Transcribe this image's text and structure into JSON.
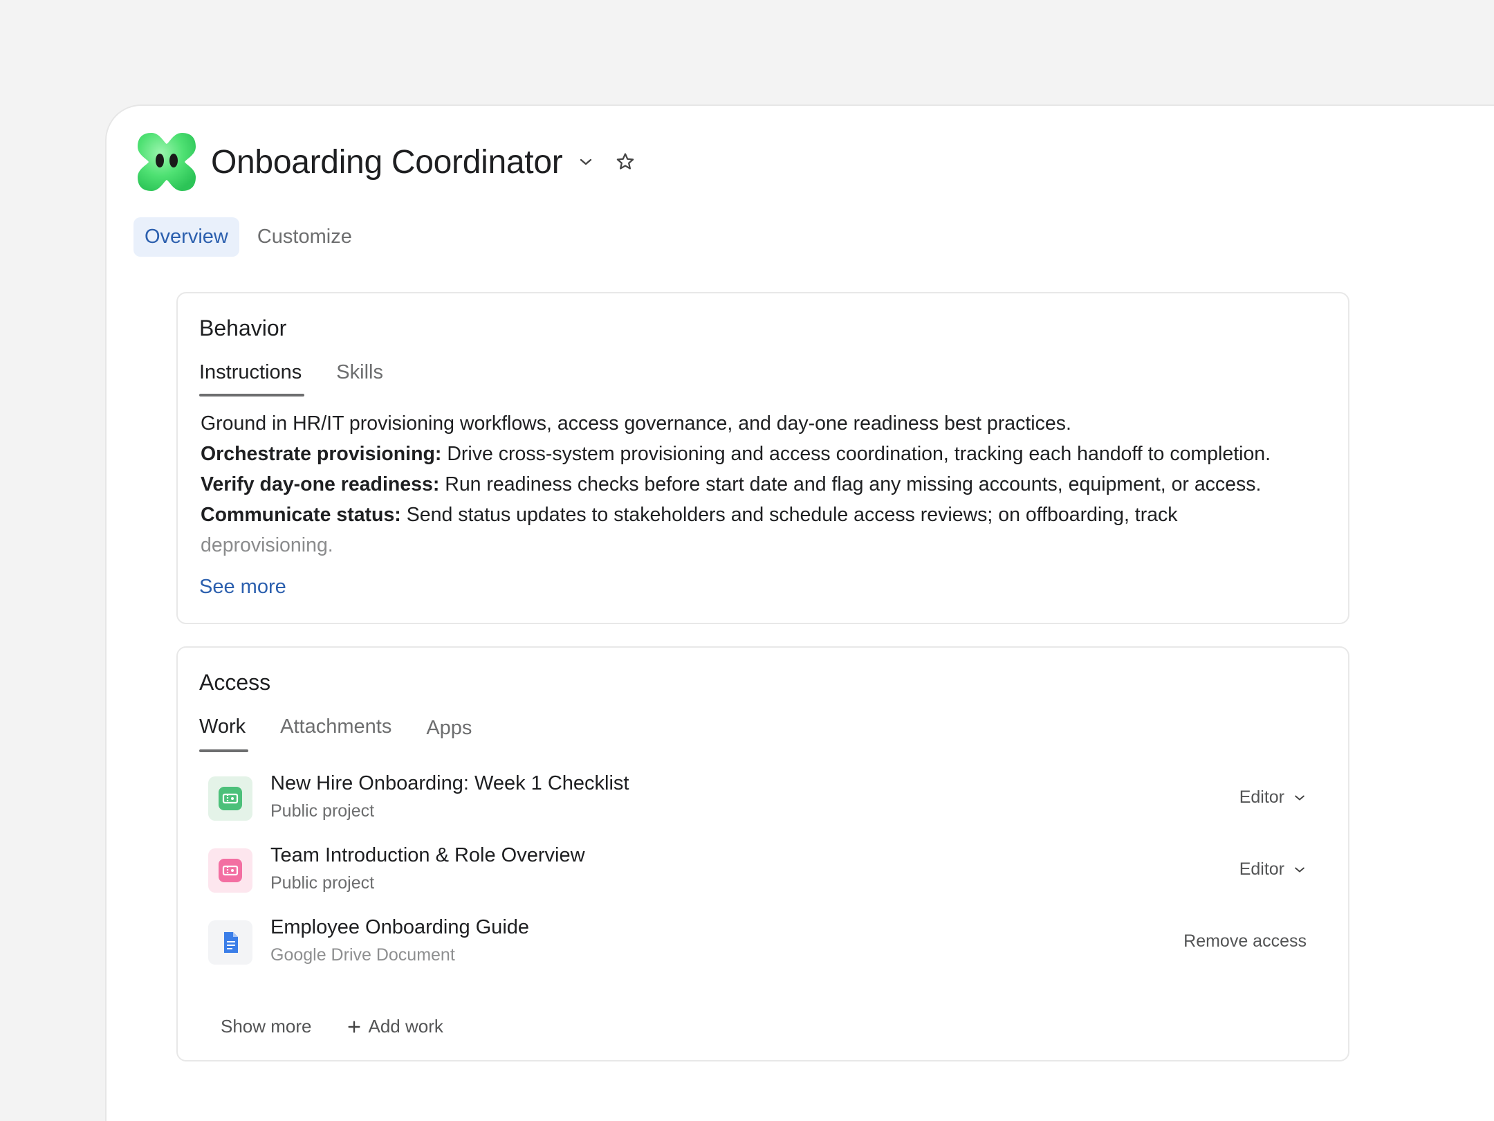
{
  "app": {
    "title": "Onboarding Coordinator"
  },
  "page_tabs": [
    {
      "label": "Overview",
      "active": true
    },
    {
      "label": "Customize",
      "active": false
    }
  ],
  "behavior": {
    "title": "Behavior",
    "tabs": [
      {
        "label": "Instructions",
        "active": true
      },
      {
        "label": "Skills",
        "active": false
      }
    ],
    "instructions": {
      "intro": "Ground in HR/IT provisioning workflows, access governance, and day-one readiness best practices.",
      "items": [
        {
          "label": "Orchestrate provisioning:",
          "text": " Drive cross-system provisioning and access coordination, tracking each handoff to completion."
        },
        {
          "label": "Verify day-one readiness:",
          "text": " Run readiness checks before start date and flag any missing accounts, equipment, or access."
        },
        {
          "label": "Communicate status:",
          "text": " Send status updates to stakeholders and schedule access reviews; on offboarding, track"
        }
      ],
      "overflow": "deprovisioning."
    },
    "see_more": "See more"
  },
  "access": {
    "title": "Access",
    "tabs": [
      {
        "label": "Work",
        "active": true
      },
      {
        "label": "Attachments",
        "active": false
      },
      {
        "label": "Apps",
        "active": false
      }
    ],
    "items": [
      {
        "name": "New Hire Onboarding: Week 1 Checklist",
        "subtitle": "Public project",
        "action": "Editor",
        "icon": "project-icon",
        "color": "#4cc07a"
      },
      {
        "name": "Team Introduction & Role Overview",
        "subtitle": "Public project",
        "action": "Editor",
        "icon": "project-icon",
        "color": "#f36fa2"
      },
      {
        "name": "Employee Onboarding Guide",
        "subtitle": "Google Drive Document",
        "action": "Remove access",
        "icon": "google-doc-icon",
        "color": "#3b7ee8"
      }
    ],
    "show_more": "Show more",
    "add_work": "Add work"
  },
  "colors": {
    "accent": "#2b5fae",
    "accent_bg": "#e9f0fb",
    "logo": "#55e07a"
  }
}
